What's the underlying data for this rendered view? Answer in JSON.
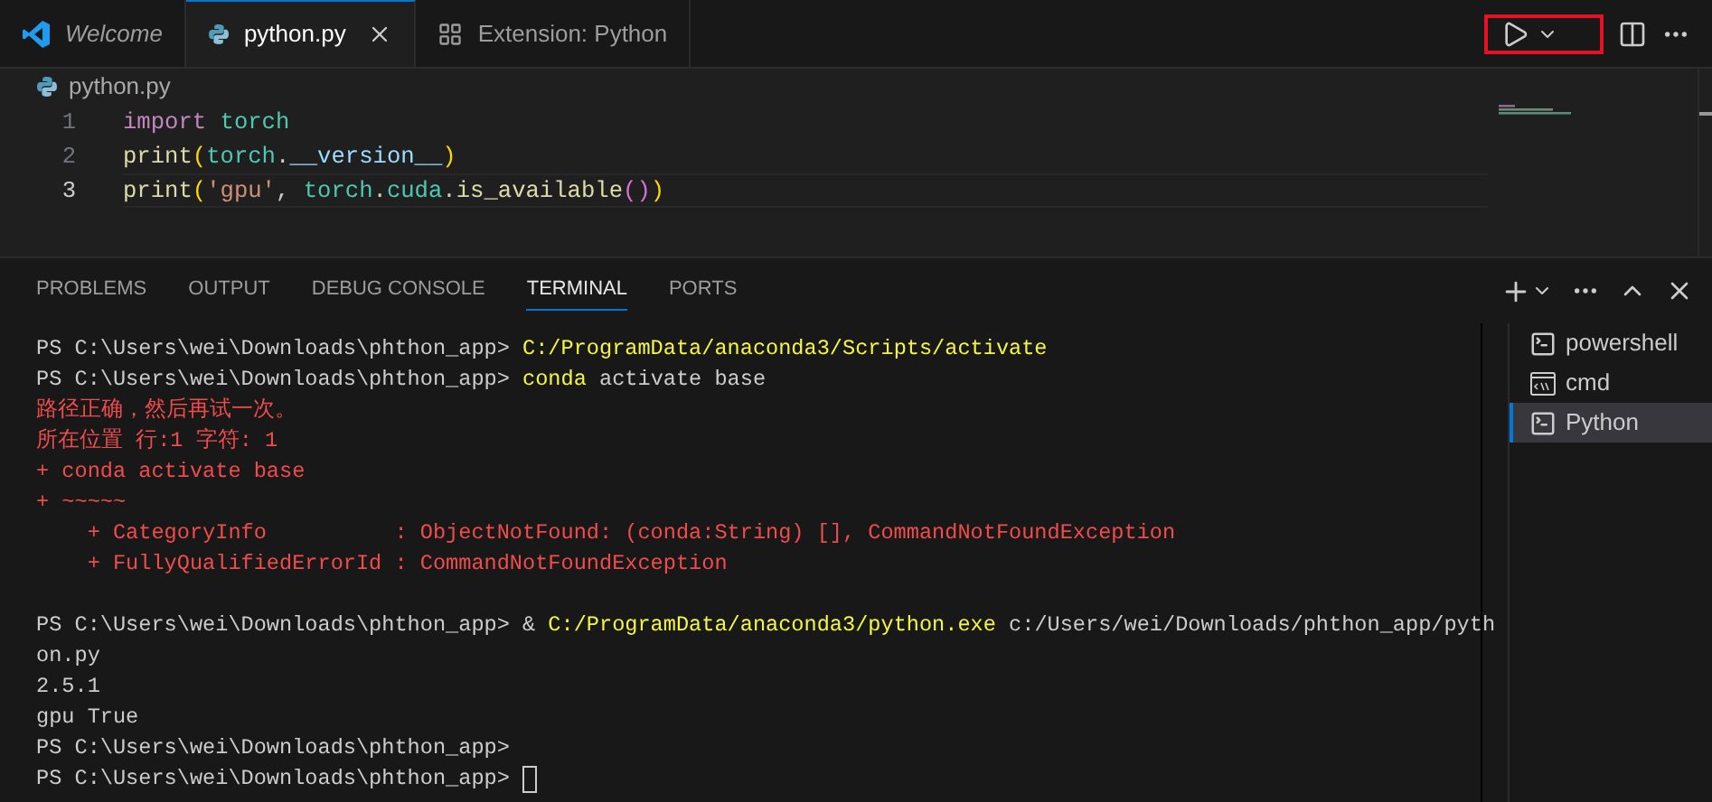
{
  "editor_tabs": [
    {
      "label": "Welcome",
      "kind": "vscode",
      "selected": false,
      "preview": true
    },
    {
      "label": "python.py",
      "kind": "python",
      "selected": true,
      "preview": false
    },
    {
      "label": "Extension: Python",
      "kind": "extension",
      "selected": false,
      "preview": false
    }
  ],
  "run_button": {
    "highlighted": true
  },
  "breadcrumb": "python.py",
  "code_lines": [
    {
      "number": "1",
      "current": false,
      "tokens": [
        {
          "text": "import ",
          "kind": "keyword"
        },
        {
          "text": "torch",
          "kind": "module"
        }
      ]
    },
    {
      "number": "2",
      "current": false,
      "tokens": [
        {
          "text": "print",
          "kind": "function"
        },
        {
          "text": "(",
          "kind": "bracket"
        },
        {
          "text": "torch",
          "kind": "module"
        },
        {
          "text": ".",
          "kind": "plain"
        },
        {
          "text": "__version__",
          "kind": "variable"
        },
        {
          "text": ")",
          "kind": "bracket"
        }
      ]
    },
    {
      "number": "3",
      "current": true,
      "tokens": [
        {
          "text": "print",
          "kind": "function"
        },
        {
          "text": "(",
          "kind": "bracket"
        },
        {
          "text": "'gpu'",
          "kind": "string"
        },
        {
          "text": ", ",
          "kind": "plain"
        },
        {
          "text": "torch",
          "kind": "module"
        },
        {
          "text": ".",
          "kind": "plain"
        },
        {
          "text": "cuda",
          "kind": "module"
        },
        {
          "text": ".",
          "kind": "plain"
        },
        {
          "text": "is_available",
          "kind": "function"
        },
        {
          "text": "()",
          "kind": "bracket2"
        },
        {
          "text": ")",
          "kind": "bracket"
        }
      ]
    }
  ],
  "panel_tabs": [
    {
      "label": "PROBLEMS",
      "selected": false
    },
    {
      "label": "OUTPUT",
      "selected": false
    },
    {
      "label": "DEBUG CONSOLE",
      "selected": false
    },
    {
      "label": "TERMINAL",
      "selected": true
    },
    {
      "label": "PORTS",
      "selected": false
    }
  ],
  "terminal_lines": [
    {
      "segments": [
        {
          "text": "PS C:\\Users\\wei\\Downloads\\phthon_app> ",
          "kind": "plain"
        },
        {
          "text": "C:/ProgramData/anaconda3/Scripts/activate",
          "kind": "command"
        }
      ]
    },
    {
      "segments": [
        {
          "text": "PS C:\\Users\\wei\\Downloads\\phthon_app> ",
          "kind": "plain"
        },
        {
          "text": "conda",
          "kind": "command"
        },
        {
          "text": " activate base",
          "kind": "plain"
        }
      ]
    },
    {
      "segments": [
        {
          "text": "路径正确，然后再试一次。",
          "kind": "error"
        }
      ]
    },
    {
      "segments": [
        {
          "text": "所在位置 行:1 字符: 1",
          "kind": "error"
        }
      ]
    },
    {
      "segments": [
        {
          "text": "+ conda activate base",
          "kind": "error"
        }
      ]
    },
    {
      "segments": [
        {
          "text": "+ ~~~~~",
          "kind": "error"
        }
      ]
    },
    {
      "segments": [
        {
          "text": "    + CategoryInfo          : ObjectNotFound: (conda:String) [], CommandNotFoundException",
          "kind": "error"
        }
      ]
    },
    {
      "segments": [
        {
          "text": "    + FullyQualifiedErrorId : CommandNotFoundException",
          "kind": "error"
        }
      ]
    },
    {
      "blank_line_before": true,
      "segments": [
        {
          "text": "PS C:\\Users\\wei\\Downloads\\phthon_app> & ",
          "kind": "plain"
        },
        {
          "text": "C:/ProgramData/anaconda3/python.exe",
          "kind": "command"
        },
        {
          "text": " c:/Users/wei/Downloads/phthon_app/pyth",
          "kind": "plain"
        }
      ]
    },
    {
      "segments": [
        {
          "text": "on.py",
          "kind": "plain"
        }
      ]
    },
    {
      "segments": [
        {
          "text": "2.5.1",
          "kind": "plain"
        }
      ]
    },
    {
      "segments": [
        {
          "text": "gpu True",
          "kind": "plain"
        }
      ]
    },
    {
      "segments": [
        {
          "text": "PS C:\\Users\\wei\\Downloads\\phthon_app>",
          "kind": "plain"
        }
      ]
    },
    {
      "cursor": true,
      "segments": [
        {
          "text": "PS C:\\Users\\wei\\Downloads\\phthon_app> ",
          "kind": "plain"
        }
      ]
    }
  ],
  "terminals": [
    {
      "label": "powershell",
      "kind": "shell",
      "selected": false
    },
    {
      "label": "cmd",
      "kind": "cmd",
      "selected": false
    },
    {
      "label": "Python",
      "kind": "shell",
      "selected": true
    }
  ]
}
